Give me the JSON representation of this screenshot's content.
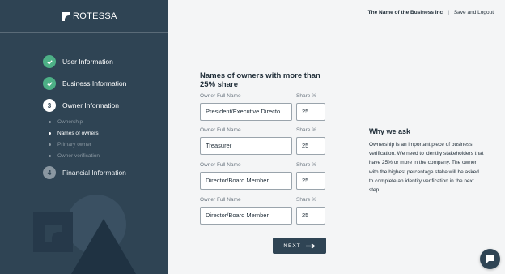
{
  "brand": {
    "name": "ROTESSA"
  },
  "header": {
    "business_name": "The Name of the Business Inc",
    "separator": "|",
    "logout_label": "Save and Logout"
  },
  "steps": [
    {
      "label": "User Information",
      "status": "done"
    },
    {
      "label": "Business Information",
      "status": "done"
    },
    {
      "label": "Owner Information",
      "status": "active",
      "number": "3"
    },
    {
      "label": "Financial Information",
      "status": "todo",
      "number": "4"
    }
  ],
  "substeps": [
    {
      "label": "Ownership",
      "active": false
    },
    {
      "label": "Names of owners",
      "active": true
    },
    {
      "label": "Primary owner",
      "active": false
    },
    {
      "label": "Owner verification",
      "active": false
    }
  ],
  "form": {
    "title": "Names of owners with more than 25% share",
    "name_label": "Owner Full Name",
    "share_label": "Share %",
    "owners": [
      {
        "name": "President/Executive Directo",
        "share": "25"
      },
      {
        "name": "Treasurer",
        "share": "25"
      },
      {
        "name": "Director/Board Member",
        "share": "25"
      },
      {
        "name": "Director/Board Member",
        "share": "25"
      }
    ],
    "next_label": "NEXT"
  },
  "why": {
    "title": "Why we ask",
    "text": "Ownership is an important piece of business verification. We need to identify stakeholders that have 25% or more in the company. The owner with the highest percentage stake will be asked to complete an identity verification in the next step."
  },
  "colors": {
    "sidebar": "#2f4454",
    "check": "#4db086",
    "background": "#f4f5f6"
  },
  "icons": {
    "check": "check-icon",
    "arrow": "arrow-right-icon",
    "chat": "chat-icon"
  }
}
